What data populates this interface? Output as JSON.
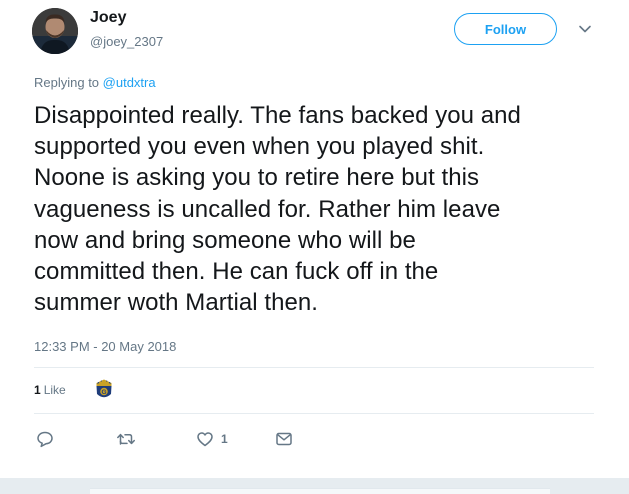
{
  "author": {
    "display_name": "Joey",
    "screen_name": "@joey_2307"
  },
  "header": {
    "follow_label": "Follow"
  },
  "reply": {
    "prefix": "Replying to ",
    "handle": "@utdxtra"
  },
  "tweet": {
    "lines": [
      "Disappointed really. The fans backed you and",
      "supported you even when you played shit.",
      "Noone is asking you to retire here but this",
      "vagueness is uncalled for. Rather him leave",
      "now and bring someone who will be",
      "committed then. He can fuck off in the",
      "summer woth Martial then."
    ],
    "timestamp": "12:33 PM - 20 May 2018"
  },
  "stats": {
    "likes_count": "1",
    "likes_label": "Like"
  },
  "actions": {
    "like_count": "1"
  },
  "icons": {
    "reply": "reply-icon",
    "retweet": "retweet-icon",
    "like": "heart-icon",
    "message": "envelope-icon",
    "caret": "chevron-down-icon"
  },
  "colors": {
    "accent": "#1da1f2",
    "secondary_text": "#657786",
    "primary_text": "#14171a",
    "border": "#e6ecf0"
  }
}
